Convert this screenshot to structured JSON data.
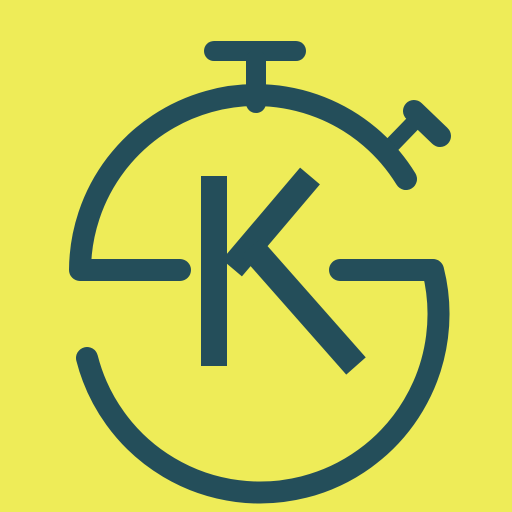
{
  "app_icon": {
    "symbol": "stopwatch-icon",
    "letter": "K",
    "colors": {
      "background": "#eeec58",
      "foreground": "#244e5a"
    }
  }
}
